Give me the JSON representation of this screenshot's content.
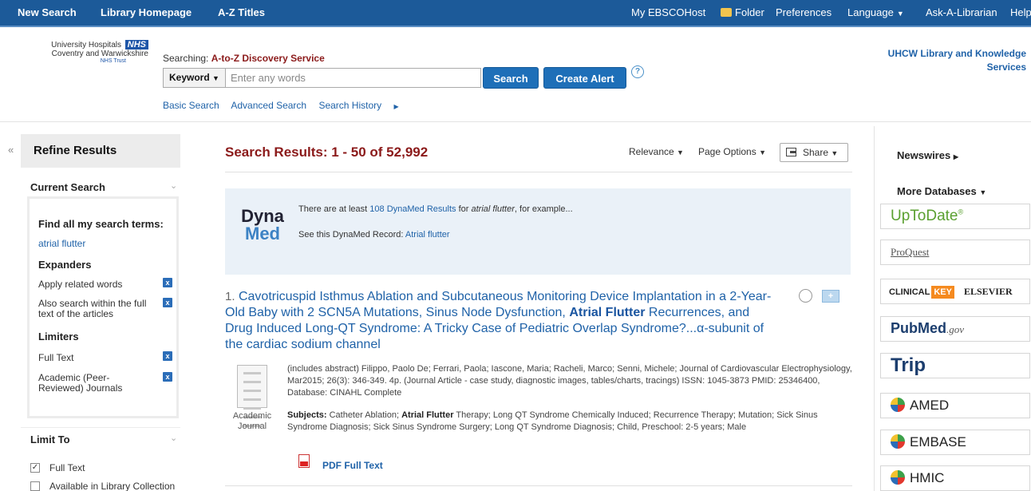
{
  "topnav": {
    "new_search": "New Search",
    "library_homepage": "Library Homepage",
    "az_titles": "A-Z Titles",
    "my_ebscohost": "My EBSCOHost",
    "folder": "Folder",
    "preferences": "Preferences",
    "language": "Language",
    "ask_librarian": "Ask-A-Librarian",
    "help": "Help"
  },
  "header": {
    "logo_line1": "University Hospitals",
    "logo_nhs": "NHS",
    "logo_line2": "Coventry and Warwickshire",
    "logo_line3": "NHS Trust",
    "searching_label": "Searching:",
    "searching_db": "A-to-Z Discovery Service",
    "field_select": "Keyword",
    "search_placeholder": "Enter any words",
    "search_button": "Search",
    "create_alert_button": "Create Alert",
    "help_glyph": "?",
    "basic_search": "Basic Search",
    "advanced_search": "Advanced Search",
    "search_history": "Search History",
    "library_name": "UHCW Library and Knowledge Services"
  },
  "left": {
    "collapse_glyph": "«",
    "refine_title": "Refine Results",
    "current_search": "Current Search",
    "find_all_label": "Find all my search terms:",
    "search_term": "atrial flutter",
    "expanders_label": "Expanders",
    "expander1": "Apply related words",
    "expander2": "Also search within the full text of the articles",
    "limiters_label": "Limiters",
    "limiter1": "Full Text",
    "limiter2": "Academic (Peer-Reviewed) Journals",
    "remove_glyph": "x",
    "limit_to": "Limit To",
    "limit_full_text": "Full Text",
    "limit_library_collection": "Available in Library Collection"
  },
  "results": {
    "title": "Search Results: 1 - 50 of 52,992",
    "relevance": "Relevance",
    "page_options": "Page Options",
    "share": "Share",
    "dyna_pre": "There are at least",
    "dyna_link": "108 DynaMed Results",
    "dyna_mid": "for",
    "dyna_term": "atrial flutter",
    "dyna_post": ", for example...",
    "dyna_record_label": "See this DynaMed Record:",
    "dyna_record_link": "Atrial flutter",
    "dyna_logo_top": "Dyna",
    "dyna_logo_bottom": "Med",
    "item1": {
      "number": "1.",
      "title_part1": "Cavotricuspid Isthmus Ablation and Subcutaneous Monitoring Device Implantation in a 2-Year-Old Baby with 2 SCN5A Mutations, Sinus Node Dysfunction,",
      "title_bold": "Atrial Flutter",
      "title_part2": "Recurrences, and Drug Induced Long-QT Syndrome: A Tricky Case of Pediatric Overlap Syndrome?...α-subunit of the cardiac sodium channel",
      "details": "(includes abstract) Filippo, Paolo De; Ferrari, Paola; Iascone, Maria; Racheli, Marco; Senni, Michele; Journal of Cardiovascular Electrophysiology, Mar2015; 26(3): 346-349. 4p. (Journal Article - case study, diagnostic images, tables/charts, tracings) ISSN: 1045-3873 PMID: 25346400, Database: CINAHL Complete",
      "subjects_label": "Subjects:",
      "subjects_pre": "Catheter Ablation;",
      "subjects_bold": "Atrial Flutter",
      "subjects_post": "Therapy; Long QT Syndrome Chemically Induced; Recurrence Therapy; Mutation; Sick Sinus Syndrome Diagnosis; Sick Sinus Syndrome Surgery; Long QT Syndrome Diagnosis; Child, Preschool: 2-5 years; Male",
      "type_label": "Academic Journal",
      "pdf_label": "PDF Full Text",
      "add_glyph": "+"
    }
  },
  "right": {
    "newswires": "Newswires",
    "more_databases": "More Databases",
    "uptodate": "UpToDate",
    "uptodate_reg": "®",
    "proquest": "ProQuest",
    "clinical": "CLINICAL",
    "key": "KEY",
    "elsevier": "ELSEVIER",
    "pubmed": "PubMed",
    "pubmed_gov": ".gov",
    "trip": "Trip",
    "amed": "AMED",
    "embase": "EMBASE",
    "hmic": "HMIC"
  }
}
